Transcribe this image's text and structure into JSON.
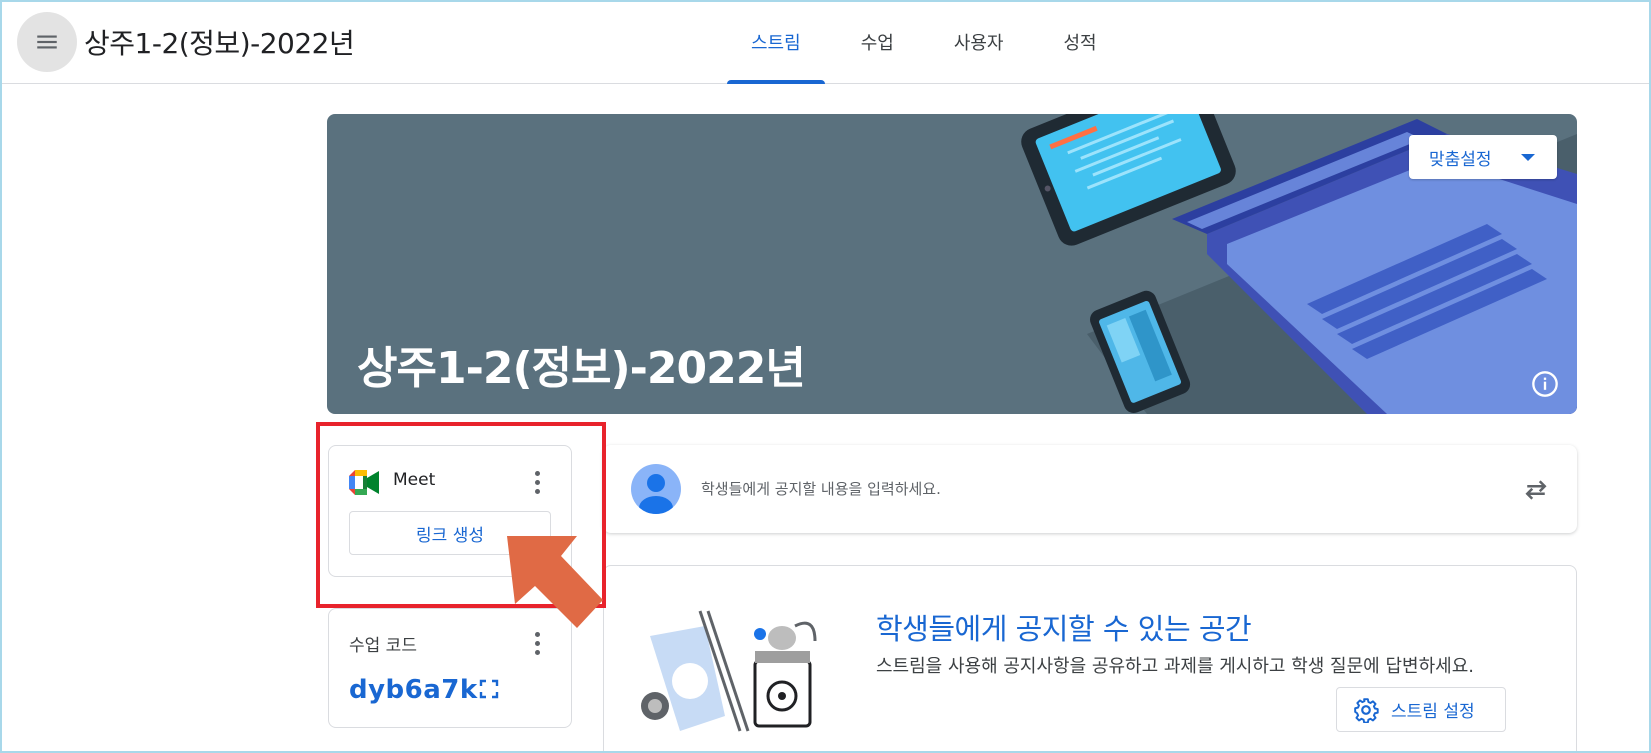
{
  "header": {
    "class_title": "상주1-2(정보)-2022년",
    "tabs": [
      {
        "label": "스트림",
        "active": true
      },
      {
        "label": "수업",
        "active": false
      },
      {
        "label": "사용자",
        "active": false
      },
      {
        "label": "성적",
        "active": false
      }
    ],
    "menu_icon": "hamburger-menu-icon"
  },
  "banner": {
    "title": "상주1-2(정보)-2022년",
    "customize_label": "맞춤설정",
    "info_icon": "info-icon",
    "background_color": "#5a717e"
  },
  "meet_card": {
    "label": "Meet",
    "create_link_label": "링크 생성",
    "more_icon": "more-vert-icon"
  },
  "class_code_card": {
    "label": "수업 코드",
    "code": "dyb6a7k",
    "more_icon": "more-vert-icon",
    "expand_icon": "fullscreen-icon"
  },
  "composer": {
    "placeholder": "학생들에게 공지할 내용을 입력하세요.",
    "repost_icon": "repost-icon"
  },
  "empty_stream": {
    "title": "학생들에게 공지할 수 있는 공간",
    "description": "스트림을 사용해 공지사항을 공유하고 과제를 게시하고 학생 질문에 답변하세요.",
    "settings_label": "스트림 설정",
    "settings_icon": "gear-icon"
  },
  "colors": {
    "accent": "#1967d2",
    "annotation_red": "#e8232c",
    "annotation_arrow": "#e06a45"
  }
}
